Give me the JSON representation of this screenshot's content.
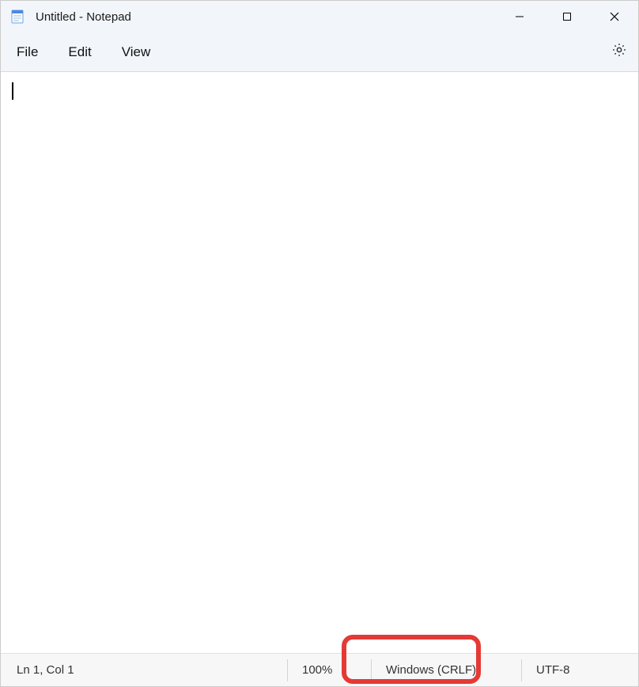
{
  "title": "Untitled - Notepad",
  "menu": {
    "file": "File",
    "edit": "Edit",
    "view": "View"
  },
  "editor": {
    "content": ""
  },
  "status": {
    "position": "Ln 1, Col 1",
    "zoom": "100%",
    "line_ending": "Windows (CRLF)",
    "encoding": "UTF-8"
  }
}
